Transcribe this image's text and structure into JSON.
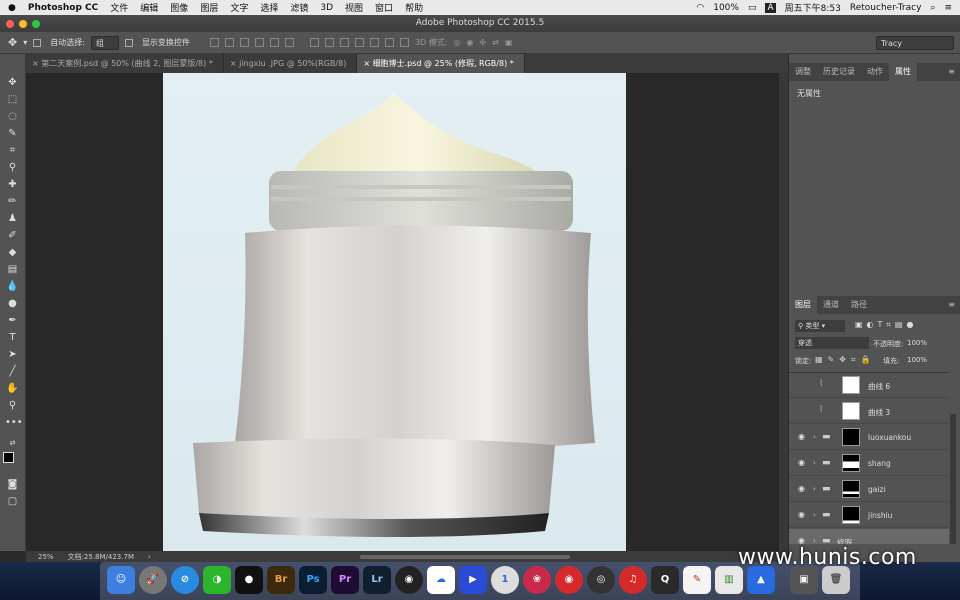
{
  "menubar": {
    "apple": "",
    "app": "Photoshop CC",
    "items": [
      "文件",
      "编辑",
      "图像",
      "图层",
      "文字",
      "选择",
      "滤镜",
      "3D",
      "视图",
      "窗口",
      "帮助"
    ],
    "battery": "100%",
    "clock": "周五下午8:53",
    "user": "Retoucher-Tracy"
  },
  "window": {
    "title": "Adobe Photoshop CC 2015.5"
  },
  "options": {
    "auto_select_label": "自动选择:",
    "auto_select_value": "组",
    "show_transform_label": "显示变换控件",
    "mode_3d": "3D 模式:",
    "workspace": "Tracy"
  },
  "tabs": [
    {
      "label": "第二天案例.psd @ 50% (曲线 2, 图层蒙版/8) *"
    },
    {
      "label": "jingxiu .JPG @ 50%(RGB/8)"
    },
    {
      "label": "细胞博士.psd @ 25% (修瑕, RGB/8) *"
    }
  ],
  "status": {
    "zoom": "25%",
    "doc": "文档:25.8M/423.7M"
  },
  "props_panel": {
    "tabs": [
      "调整",
      "历史记录",
      "动作",
      "属性"
    ],
    "empty": "无属性"
  },
  "layers_panel": {
    "tabs": [
      "图层",
      "通道",
      "路径"
    ],
    "filter": "类型",
    "blend": "穿透",
    "opacity_label": "不透明度:",
    "opacity": "100%",
    "lock_label": "锁定:",
    "fill_label": "填充:",
    "fill": "100%",
    "layers": [
      {
        "name": "曲线 6",
        "visible": false,
        "type": "adjust"
      },
      {
        "name": "曲线 3",
        "visible": false,
        "type": "adjust"
      },
      {
        "name": "luoxuankou",
        "visible": true,
        "type": "group"
      },
      {
        "name": "shang",
        "visible": true,
        "type": "group"
      },
      {
        "name": "gaizi",
        "visible": true,
        "type": "group"
      },
      {
        "name": "jinshiu",
        "visible": true,
        "type": "group"
      },
      {
        "name": "修瑕",
        "visible": true,
        "type": "group"
      }
    ]
  },
  "dock": {
    "labels": [
      "Br",
      "Ps",
      "Pr",
      "Lr"
    ]
  },
  "watermark": "www.hunis.com",
  "colors": {
    "panel": "#535353",
    "canvas_bg": "#e3eff2",
    "accent": "#1e8bd0"
  }
}
